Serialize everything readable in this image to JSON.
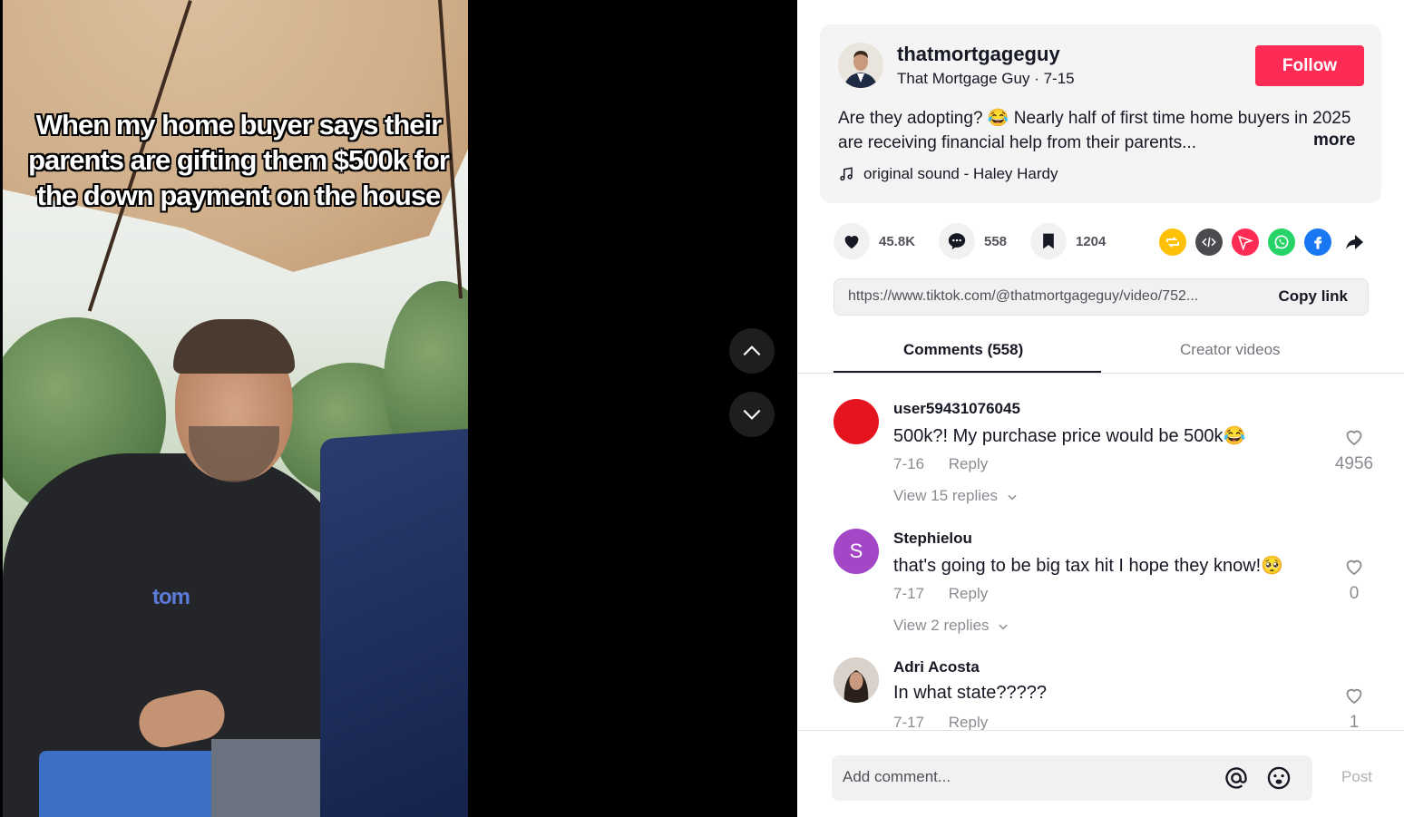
{
  "video": {
    "caption": "When my home buyer says their parents are gifting them $500k for the down payment on the house",
    "shirt_logo": "tom"
  },
  "post": {
    "username": "thatmortgageguy",
    "display_name": "That Mortgage Guy",
    "date": "7-15",
    "follow_label": "Follow",
    "description": "Are they adopting? 😂 Nearly half of first time home buyers in 2025 are receiving financial help from their parents...",
    "more_label": "more",
    "sound": "original sound - Haley Hardy"
  },
  "actions": {
    "likes": "45.8K",
    "comments": "558",
    "saves": "1204"
  },
  "share": {
    "link": "https://www.tiktok.com/@thatmortgageguy/video/752...",
    "copy_label": "Copy link",
    "icons": [
      "repost-icon",
      "embed-icon",
      "send-icon",
      "whatsapp-icon",
      "facebook-icon",
      "share-arrow-icon"
    ]
  },
  "tabs": {
    "comments": "Comments (558)",
    "creator_videos": "Creator videos"
  },
  "comments": [
    {
      "user": "user59431076045",
      "text": "500k?! My purchase price would be 500k😂",
      "date": "7-16",
      "reply": "Reply",
      "likes": "4956",
      "view_replies": "View 15 replies",
      "avatar_color": "#e6141e",
      "avatar_letter": ""
    },
    {
      "user": "Stephielou",
      "text": "that's going to be big tax hit I hope they know!🥺",
      "date": "7-17",
      "reply": "Reply",
      "likes": "0",
      "view_replies": "View 2 replies",
      "avatar_color": "#a347c7",
      "avatar_letter": "S"
    },
    {
      "user": "Adri Acosta",
      "text": "In what state?????",
      "date": "7-17",
      "reply": "Reply",
      "likes": "1",
      "avatar_color": "#cfc8c0",
      "avatar_letter": ""
    }
  ],
  "footer": {
    "placeholder": "Add comment...",
    "post_label": "Post"
  },
  "colors": {
    "follow": "#fe2c55",
    "repost": "#ffc107",
    "embed": "#4b4b4f",
    "send": "#fe2c55",
    "whatsapp": "#25d366",
    "facebook": "#1877f2"
  }
}
